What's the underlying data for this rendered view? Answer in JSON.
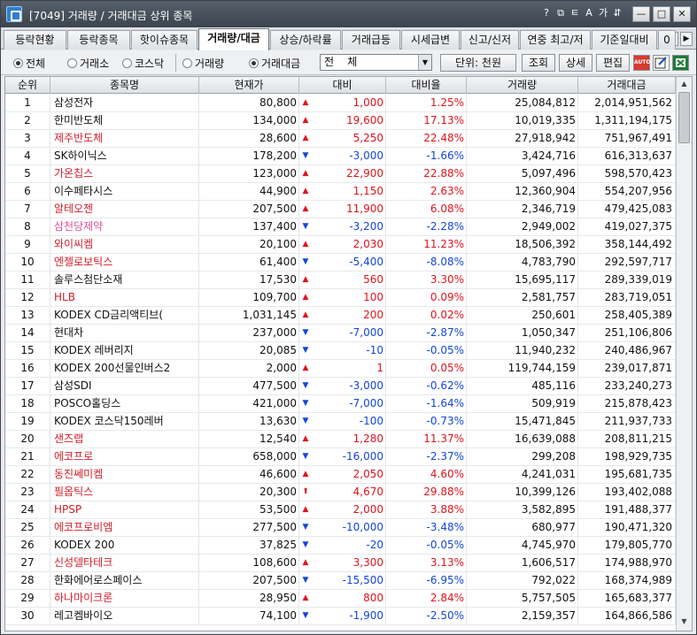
{
  "window": {
    "title": "[7049]  거래량 / 거래대금 상위 종목",
    "tool_icons": [
      "help-icon",
      "link-icon",
      "chart-icon",
      "font-icon",
      "font-size-icon",
      "pin-icon"
    ],
    "tool_glyphs": [
      "?",
      "⧉",
      "ㅌ",
      "A",
      "가",
      "⇵"
    ],
    "controls": {
      "minimize": "—",
      "maximize": "□",
      "close": "✕"
    }
  },
  "tabs": [
    {
      "label": "등락현황",
      "active": false
    },
    {
      "label": "등락종목",
      "active": false
    },
    {
      "label": "핫이슈종목",
      "active": false
    },
    {
      "label": "거래량/대금",
      "active": true
    },
    {
      "label": "상승/하락률",
      "active": false
    },
    {
      "label": "거래급등",
      "active": false
    },
    {
      "label": "시세급변",
      "active": false
    },
    {
      "label": "신고/신저",
      "active": false
    },
    {
      "label": "연중 최고/저",
      "active": false
    },
    {
      "label": "기준일대비",
      "active": false
    },
    {
      "label": "0",
      "active": false
    }
  ],
  "tab_nav": {
    "prev": "◀",
    "next": "▶"
  },
  "filters": {
    "market": [
      {
        "label": "전체",
        "selected": true
      },
      {
        "label": "거래소",
        "selected": false
      },
      {
        "label": "코스닥",
        "selected": false
      }
    ],
    "sort_by": [
      {
        "label": "거래량",
        "selected": false
      },
      {
        "label": "거래대금",
        "selected": true
      }
    ],
    "category_select": "전    체",
    "unit_button": "단위: 천원",
    "query_button": "조회",
    "detail_button": "상세",
    "edit_button": "편집",
    "auto_label": "AUTO"
  },
  "table": {
    "columns": [
      "순위",
      "종목명",
      "현재가",
      "대비",
      "대비율",
      "거래량",
      "거래대금"
    ],
    "rows": [
      {
        "rank": "1",
        "name": "삼성전자",
        "name_color": "default",
        "price": "80,800",
        "dir": "up",
        "change": "1,000",
        "pct": "1.25%",
        "volume": "25,084,812",
        "amount": "2,014,951,562"
      },
      {
        "rank": "2",
        "name": "한미반도체",
        "name_color": "default",
        "price": "134,000",
        "dir": "up",
        "change": "19,600",
        "pct": "17.13%",
        "volume": "10,019,335",
        "amount": "1,311,194,175"
      },
      {
        "rank": "3",
        "name": "제주반도체",
        "name_color": "red",
        "price": "28,600",
        "dir": "up",
        "change": "5,250",
        "pct": "22.48%",
        "volume": "27,918,942",
        "amount": "751,967,491"
      },
      {
        "rank": "4",
        "name": "SK하이닉스",
        "name_color": "default",
        "price": "178,200",
        "dir": "dn",
        "change": "-3,000",
        "pct": "-1.66%",
        "volume": "3,424,716",
        "amount": "616,313,637"
      },
      {
        "rank": "5",
        "name": "가온칩스",
        "name_color": "red",
        "price": "123,000",
        "dir": "up",
        "change": "22,900",
        "pct": "22.88%",
        "volume": "5,097,496",
        "amount": "598,570,423"
      },
      {
        "rank": "6",
        "name": "이수페타시스",
        "name_color": "default",
        "price": "44,900",
        "dir": "up",
        "change": "1,150",
        "pct": "2.63%",
        "volume": "12,360,904",
        "amount": "554,207,956"
      },
      {
        "rank": "7",
        "name": "알테오젠",
        "name_color": "red",
        "price": "207,500",
        "dir": "up",
        "change": "11,900",
        "pct": "6.08%",
        "volume": "2,346,719",
        "amount": "479,425,083"
      },
      {
        "rank": "8",
        "name": "삼천당제약",
        "name_color": "pink",
        "price": "137,400",
        "dir": "dn",
        "change": "-3,200",
        "pct": "-2.28%",
        "volume": "2,949,002",
        "amount": "419,027,375"
      },
      {
        "rank": "9",
        "name": "와이씨켐",
        "name_color": "red",
        "price": "20,100",
        "dir": "up",
        "change": "2,030",
        "pct": "11.23%",
        "volume": "18,506,392",
        "amount": "358,144,492"
      },
      {
        "rank": "10",
        "name": "엔젤로보틱스",
        "name_color": "red",
        "price": "61,400",
        "dir": "dn",
        "change": "-5,400",
        "pct": "-8.08%",
        "volume": "4,783,790",
        "amount": "292,597,717"
      },
      {
        "rank": "11",
        "name": "솔루스첨단소재",
        "name_color": "default",
        "price": "17,530",
        "dir": "up",
        "change": "560",
        "pct": "3.30%",
        "volume": "15,695,117",
        "amount": "289,339,019"
      },
      {
        "rank": "12",
        "name": "HLB",
        "name_color": "red",
        "price": "109,700",
        "dir": "up",
        "change": "100",
        "pct": "0.09%",
        "volume": "2,581,757",
        "amount": "283,719,051"
      },
      {
        "rank": "13",
        "name": "KODEX CD금리액티브(",
        "name_color": "default",
        "price": "1,031,145",
        "dir": "up",
        "change": "200",
        "pct": "0.02%",
        "volume": "250,601",
        "amount": "258,405,389"
      },
      {
        "rank": "14",
        "name": "현대차",
        "name_color": "default",
        "price": "237,000",
        "dir": "dn",
        "change": "-7,000",
        "pct": "-2.87%",
        "volume": "1,050,347",
        "amount": "251,106,806"
      },
      {
        "rank": "15",
        "name": "KODEX 레버리지",
        "name_color": "default",
        "price": "20,085",
        "dir": "dn",
        "change": "-10",
        "pct": "-0.05%",
        "volume": "11,940,232",
        "amount": "240,486,967"
      },
      {
        "rank": "16",
        "name": "KODEX 200선물인버스2",
        "name_color": "default",
        "price": "2,000",
        "dir": "up",
        "change": "1",
        "pct": "0.05%",
        "volume": "119,744,159",
        "amount": "239,017,871"
      },
      {
        "rank": "17",
        "name": "삼성SDI",
        "name_color": "default",
        "price": "477,500",
        "dir": "dn",
        "change": "-3,000",
        "pct": "-0.62%",
        "volume": "485,116",
        "amount": "233,240,273"
      },
      {
        "rank": "18",
        "name": "POSCO홀딩스",
        "name_color": "default",
        "price": "421,000",
        "dir": "dn",
        "change": "-7,000",
        "pct": "-1.64%",
        "volume": "509,919",
        "amount": "215,878,423"
      },
      {
        "rank": "19",
        "name": "KODEX 코스닥150레버",
        "name_color": "default",
        "price": "13,630",
        "dir": "dn",
        "change": "-100",
        "pct": "-0.73%",
        "volume": "15,471,845",
        "amount": "211,937,733"
      },
      {
        "rank": "20",
        "name": "샌즈랩",
        "name_color": "red",
        "price": "12,540",
        "dir": "up",
        "change": "1,280",
        "pct": "11.37%",
        "volume": "16,639,088",
        "amount": "208,811,215"
      },
      {
        "rank": "21",
        "name": "에코프로",
        "name_color": "red",
        "price": "658,000",
        "dir": "dn",
        "change": "-16,000",
        "pct": "-2.37%",
        "volume": "299,208",
        "amount": "198,929,735"
      },
      {
        "rank": "22",
        "name": "동진쎄미켐",
        "name_color": "red",
        "price": "46,600",
        "dir": "up",
        "change": "2,050",
        "pct": "4.60%",
        "volume": "4,241,031",
        "amount": "195,681,735"
      },
      {
        "rank": "23",
        "name": "필옵틱스",
        "name_color": "red",
        "price": "20,300",
        "dir": "limit",
        "change": "4,670",
        "pct": "29.88%",
        "volume": "10,399,126",
        "amount": "193,402,088"
      },
      {
        "rank": "24",
        "name": "HPSP",
        "name_color": "red",
        "price": "53,500",
        "dir": "up",
        "change": "2,000",
        "pct": "3.88%",
        "volume": "3,582,895",
        "amount": "191,488,377"
      },
      {
        "rank": "25",
        "name": "에코프로비엠",
        "name_color": "red",
        "price": "277,500",
        "dir": "dn",
        "change": "-10,000",
        "pct": "-3.48%",
        "volume": "680,977",
        "amount": "190,471,320"
      },
      {
        "rank": "26",
        "name": "KODEX 200",
        "name_color": "default",
        "price": "37,825",
        "dir": "dn",
        "change": "-20",
        "pct": "-0.05%",
        "volume": "4,745,970",
        "amount": "179,805,770"
      },
      {
        "rank": "27",
        "name": "신성델타테크",
        "name_color": "red",
        "price": "108,600",
        "dir": "up",
        "change": "3,300",
        "pct": "3.13%",
        "volume": "1,606,517",
        "amount": "174,988,970"
      },
      {
        "rank": "28",
        "name": "한화에어로스페이스",
        "name_color": "default",
        "price": "207,500",
        "dir": "dn",
        "change": "-15,500",
        "pct": "-6.95%",
        "volume": "792,022",
        "amount": "168,374,989"
      },
      {
        "rank": "29",
        "name": "하나마이크론",
        "name_color": "red",
        "price": "28,950",
        "dir": "up",
        "change": "800",
        "pct": "2.84%",
        "volume": "5,757,505",
        "amount": "165,683,377"
      },
      {
        "rank": "30",
        "name": "레고켐바이오",
        "name_color": "default",
        "price": "74,100",
        "dir": "dn",
        "change": "-1,900",
        "pct": "-2.50%",
        "volume": "2,159,357",
        "amount": "164,866,586"
      }
    ]
  },
  "scrollbar": {
    "up": "▲",
    "down": "▼"
  },
  "colors": {
    "up": "#e0141e",
    "down": "#1446d8",
    "name_red": "#d0202a",
    "name_pink": "#e0509a"
  }
}
